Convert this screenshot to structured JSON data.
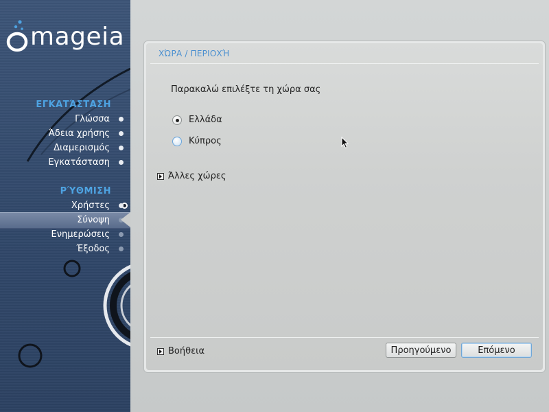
{
  "brand": {
    "logo_text": "mageia"
  },
  "sidebar": {
    "sections": [
      {
        "title": "ΕΓΚΑΤΆΣΤΑΣΗ",
        "items": [
          {
            "label": "Γλώσσα"
          },
          {
            "label": "Άδεια χρήσης"
          },
          {
            "label": "Διαμερισμός"
          },
          {
            "label": "Εγκατάσταση"
          }
        ]
      },
      {
        "title": "ΡΎΘΜΙΣΗ",
        "items": [
          {
            "label": "Χρήστες"
          },
          {
            "label": "Σύνοψη",
            "active": true
          },
          {
            "label": "Ενημερώσεις"
          },
          {
            "label": "Έξοδος"
          }
        ]
      }
    ]
  },
  "page": {
    "title": "ΧΏΡΑ / ΠΕΡΙΟΧΉ",
    "prompt": "Παρακαλώ επιλέξτε τη χώρα σας",
    "options": [
      {
        "label": "Ελλάδα",
        "selected": true
      },
      {
        "label": "Κύπρος",
        "selected": false
      }
    ],
    "other_countries": "Άλλες χώρες"
  },
  "footer": {
    "help": "Βοήθεια",
    "prev": "Προηγούμενο",
    "next": "Επόμενο"
  },
  "colors": {
    "sidebar_bg": "#34496b",
    "section_title": "#4ea3e2",
    "page_title": "#4a8fd0",
    "default_button_border": "#6fa7d8"
  }
}
